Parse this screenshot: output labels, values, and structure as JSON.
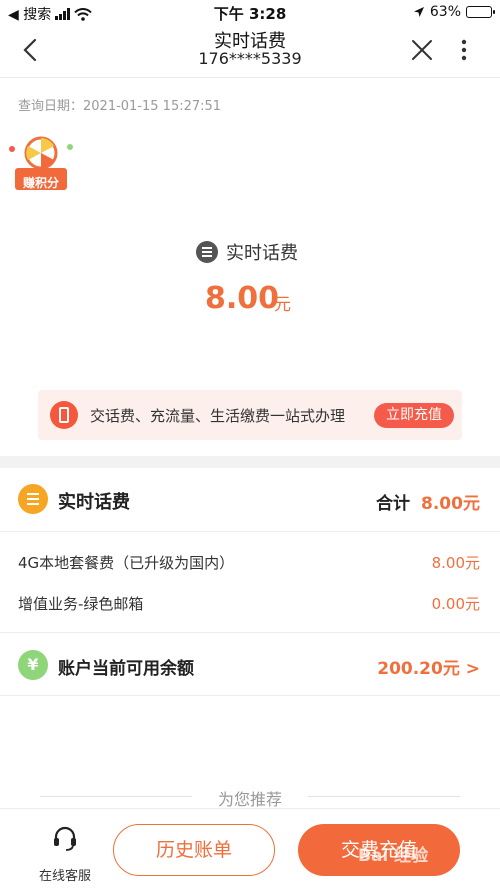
{
  "status_bar": {
    "back_app": "◀ 搜索",
    "time": "下午 3:28",
    "battery": "63%",
    "battery_level": 0.63
  },
  "nav": {
    "title": "实时话费",
    "subtitle": "176****5339"
  },
  "query_date": "查询日期：2021-01-15 15:27:51",
  "points_badge": "赚积分",
  "bill": {
    "label": "实时话费",
    "amount": "8.00",
    "unit": "元"
  },
  "promo": {
    "text": "交话费、充流量、生活缴费一站式办理",
    "button": "立即充值"
  },
  "section": {
    "title": "实时话费",
    "total_label": "合计",
    "total_value": "8.00元",
    "items": [
      {
        "name": "4G本地套餐费（已升级为国内）",
        "value": "8.00元"
      },
      {
        "name": "增值业务-绿色邮箱",
        "value": "0.00元"
      }
    ]
  },
  "balance": {
    "icon": "¥",
    "label": "账户当前可用余额",
    "value": "200.20元 >"
  },
  "recommend": "为您推荐",
  "bottom": {
    "service": "在线客服",
    "history": "历史账单",
    "pay": "交费充值",
    "watermark": "Bai 经验"
  },
  "colors": {
    "accent": "#f0703d",
    "promo_button": "#f45b4a",
    "coin_orange": "#f6a623",
    "coin_green": "#8fd67a"
  }
}
